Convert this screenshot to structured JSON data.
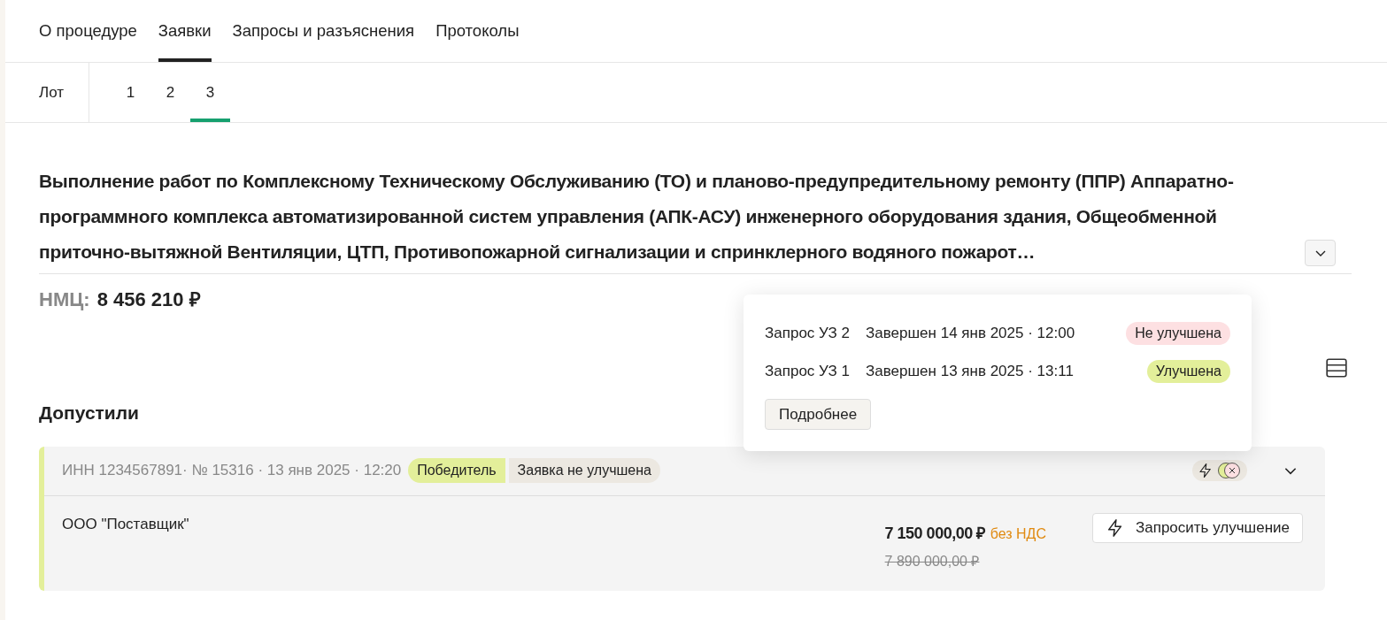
{
  "tabs": [
    {
      "label": "О процедуре",
      "selected": false
    },
    {
      "label": "Заявки",
      "selected": true
    },
    {
      "label": "Запросы и разъяснения",
      "selected": false
    },
    {
      "label": "Протоколы",
      "selected": false
    }
  ],
  "lot": {
    "label": "Лот",
    "items": [
      {
        "label": "1",
        "selected": false
      },
      {
        "label": "2",
        "selected": false
      },
      {
        "label": "3",
        "selected": true
      }
    ]
  },
  "title": "Выполнение работ по Комплексному Техническому Обслуживанию (ТО) и планово-предупредительному ремонту (ППР) Аппаратно-программного комплекса автоматизированной систем управления (АПК-АСУ) инженерного оборудования здания, Общеобменной приточно-вытяжной Вентиляции, ЦТП, Противопожарной сигнализации и спринклерного водяного пожарот…",
  "title_expanded": false,
  "nmc": {
    "label": "НМЦ:",
    "value": "8 456 210 ₽"
  },
  "popover": {
    "requests": [
      {
        "name": "Запрос УЗ 2",
        "status_text": "Завершен 14 янв 2025 · 12:00",
        "result": "Не улучшена",
        "kind": "not_improved"
      },
      {
        "name": "Запрос УЗ 1",
        "status_text": "Завершен 13 янв 2025 · 13:11",
        "result": "Улучшена",
        "kind": "improved"
      }
    ],
    "button": "Подробнее"
  },
  "section_title": "Допустили",
  "application": {
    "meta": "ИНН 1234567891· № 15316 · 13 янв 2025 · 12:20",
    "tags": [
      {
        "label": "Победитель",
        "kind": "winner"
      },
      {
        "label": "Заявка не улучшена",
        "kind": "neutral"
      }
    ],
    "expanded": true,
    "supplier": "ООО \"Поставщик\"",
    "price": "7 150 000,00 ₽",
    "vat": "без НДС",
    "old_price": "7 890 000,00 ₽",
    "button": "Запросить улучшение"
  }
}
